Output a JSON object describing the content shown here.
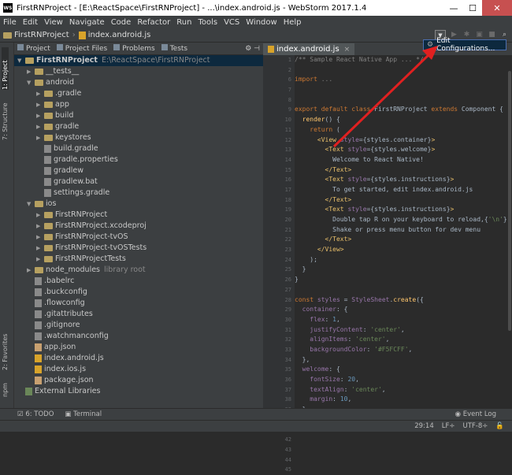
{
  "title_bar": {
    "title": "FirstRNProject - [E:\\ReactSpace\\FirstRNProject] - ...\\index.android.js - WebStorm 2017.1.4",
    "app_badge": "WS",
    "minimize": "—",
    "maximize": "☐",
    "close": "✕"
  },
  "menu": [
    "File",
    "Edit",
    "View",
    "Navigate",
    "Code",
    "Refactor",
    "Run",
    "Tools",
    "VCS",
    "Window",
    "Help"
  ],
  "navbar": {
    "project": "FirstRNProject",
    "file": "index.android.js"
  },
  "run_dropdown": {
    "label": "Edit Configurations..."
  },
  "left_strip": {
    "project": "1: Project",
    "structure": "7: Structure",
    "favorites": "2: Favorites",
    "npm": "npm"
  },
  "project_tabs": [
    "Project",
    "Project Files",
    "Problems",
    "Tests"
  ],
  "tree": [
    {
      "label": "FirstRNProject",
      "extra": "E:\\ReactSpace\\FirstRNProject",
      "arrow": "▼",
      "type": "root"
    },
    {
      "label": "__tests__",
      "arrow": "▶",
      "type": "folder"
    },
    {
      "label": "android",
      "arrow": "▼",
      "type": "folder"
    },
    {
      "label": ".gradle",
      "arrow": "▶",
      "type": "folder"
    },
    {
      "label": "app",
      "arrow": "▶",
      "type": "folder"
    },
    {
      "label": "build",
      "arrow": "▶",
      "type": "folder"
    },
    {
      "label": "gradle",
      "arrow": "▶",
      "type": "folder"
    },
    {
      "label": "keystores",
      "arrow": "▶",
      "type": "folder"
    },
    {
      "label": "build.gradle",
      "arrow": "",
      "type": "file"
    },
    {
      "label": "gradle.properties",
      "arrow": "",
      "type": "file"
    },
    {
      "label": "gradlew",
      "arrow": "",
      "type": "file"
    },
    {
      "label": "gradlew.bat",
      "arrow": "",
      "type": "file"
    },
    {
      "label": "settings.gradle",
      "arrow": "",
      "type": "file"
    },
    {
      "label": "ios",
      "arrow": "▼",
      "type": "folder"
    },
    {
      "label": "FirstRNProject",
      "arrow": "▶",
      "type": "folder"
    },
    {
      "label": "FirstRNProject.xcodeproj",
      "arrow": "▶",
      "type": "folder"
    },
    {
      "label": "FirstRNProject-tvOS",
      "arrow": "▶",
      "type": "folder"
    },
    {
      "label": "FirstRNProject-tvOSTests",
      "arrow": "▶",
      "type": "folder"
    },
    {
      "label": "FirstRNProjectTests",
      "arrow": "▶",
      "type": "folder"
    },
    {
      "label": "node_modules",
      "extra": "library root",
      "arrow": "▶",
      "type": "folder"
    },
    {
      "label": ".babelrc",
      "arrow": "",
      "type": "file"
    },
    {
      "label": ".buckconfig",
      "arrow": "",
      "type": "file"
    },
    {
      "label": ".flowconfig",
      "arrow": "",
      "type": "file"
    },
    {
      "label": ".gitattributes",
      "arrow": "",
      "type": "file"
    },
    {
      "label": ".gitignore",
      "arrow": "",
      "type": "file"
    },
    {
      "label": ".watchmanconfig",
      "arrow": "",
      "type": "file"
    },
    {
      "label": "app.json",
      "arrow": "",
      "type": "json"
    },
    {
      "label": "index.android.js",
      "arrow": "",
      "type": "js"
    },
    {
      "label": "index.ios.js",
      "arrow": "",
      "type": "js"
    },
    {
      "label": "package.json",
      "arrow": "",
      "type": "json"
    },
    {
      "label": "External Libraries",
      "arrow": "",
      "type": "lib"
    }
  ],
  "editor": {
    "tab": "index.android.js",
    "line_numbers": [
      "1",
      "2",
      "6",
      "7",
      "8",
      "9",
      "10",
      "11",
      "12",
      "13",
      "14",
      "15",
      "16",
      "17",
      "18",
      "19",
      "20",
      "21",
      "22",
      "23",
      "24",
      "25",
      "26",
      "27",
      "28",
      "29",
      "30",
      "31",
      "32",
      "33",
      "34",
      "35",
      "36",
      "37",
      "38",
      "39",
      "40",
      "41",
      "42",
      "43",
      "44",
      "45"
    ]
  },
  "bottom_tools": {
    "todo": "6: TODO",
    "terminal": "Terminal",
    "event_log": "Event Log"
  },
  "status": {
    "position": "29:14",
    "line_sep": "LF÷",
    "encoding": "UTF-8÷"
  }
}
